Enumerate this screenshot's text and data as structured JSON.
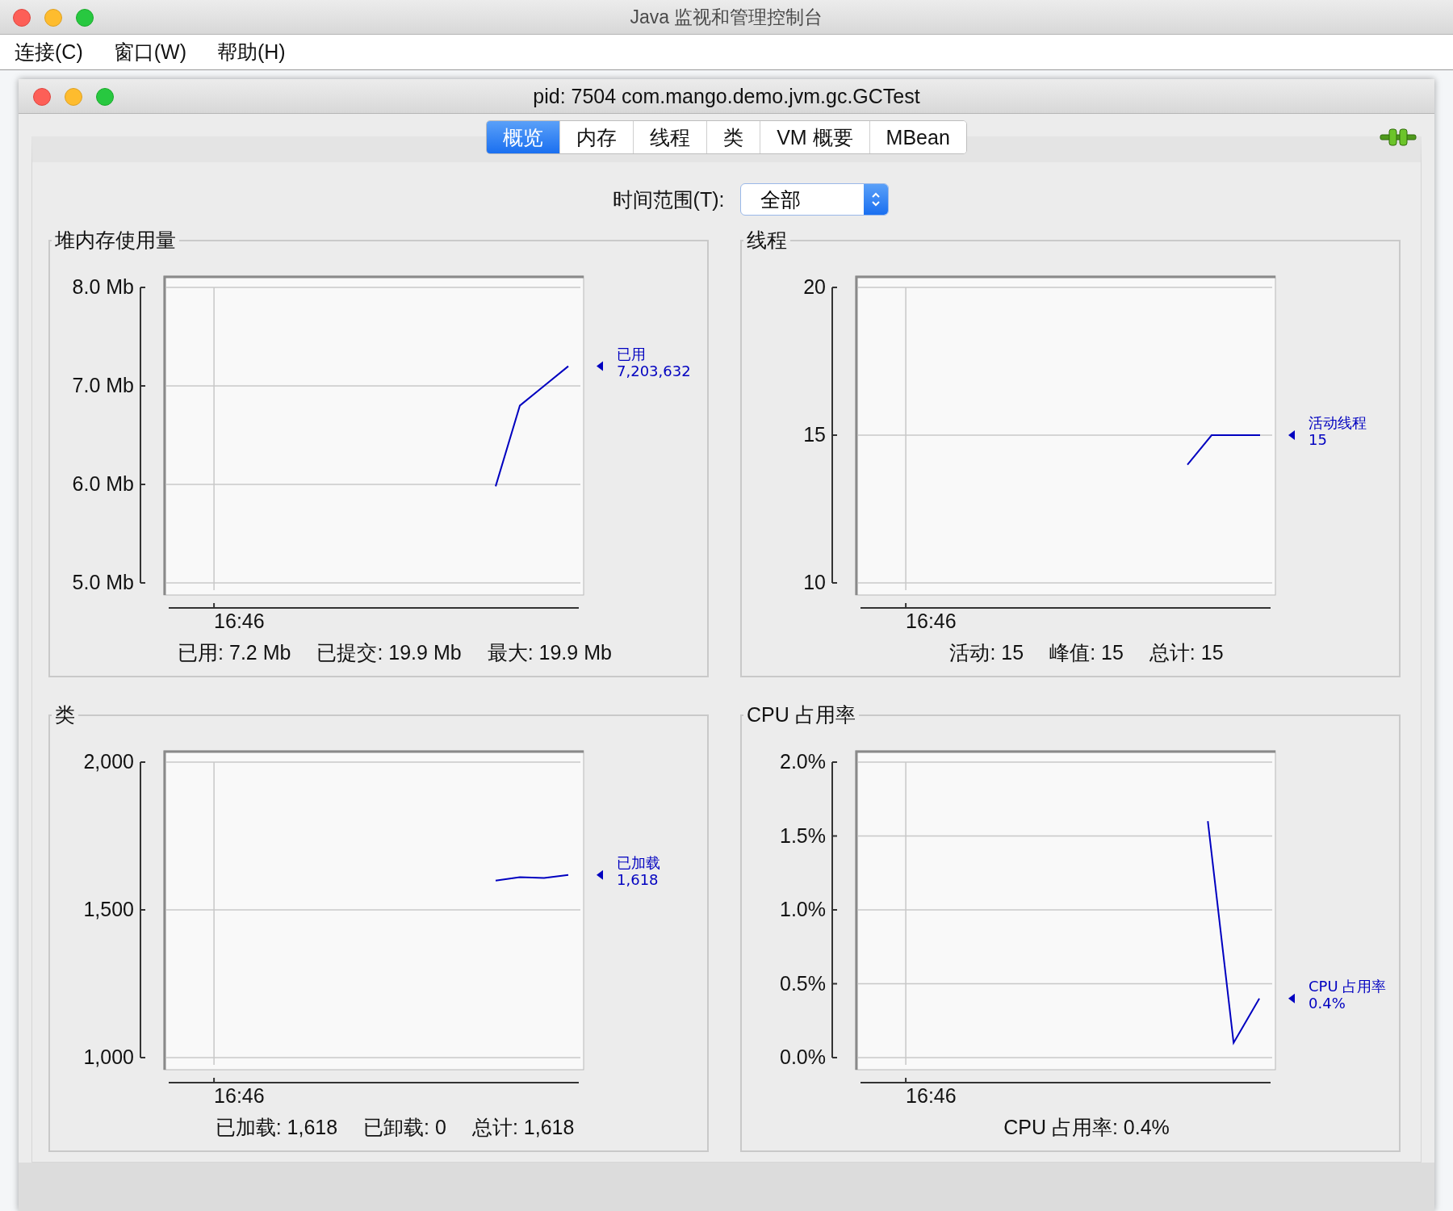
{
  "app_window": {
    "title": "Java 监视和管理控制台"
  },
  "menu": [
    "连接(C)",
    "窗口(W)",
    "帮助(H)"
  ],
  "document_window": {
    "title": "pid: 7504 com.mango.demo.jvm.gc.GCTest"
  },
  "tabs": [
    {
      "label": "概览",
      "selected": true
    },
    {
      "label": "内存",
      "selected": false
    },
    {
      "label": "线程",
      "selected": false
    },
    {
      "label": "类",
      "selected": false
    },
    {
      "label": "VM 概要",
      "selected": false
    },
    {
      "label": "MBean",
      "selected": false
    }
  ],
  "time_range": {
    "label": "时间范围(T):",
    "value": "全部"
  },
  "panels": [
    {
      "title": "堆内存使用量",
      "legend_value": "7,203,632",
      "stats": [
        "已用: 7.2 Mb",
        "已提交: 19.9 Mb",
        "最大: 19.9 Mb"
      ],
      "chart_data": {
        "type": "line",
        "grid": true,
        "annotations": [
          "16:46"
        ],
        "ylim": [
          5,
          8
        ],
        "yticks": [
          {
            "value": 5,
            "label": "5.0 Mb"
          },
          {
            "value": 6,
            "label": "6.0 Mb"
          },
          {
            "value": 7,
            "label": "7.0 Mb"
          },
          {
            "value": 8,
            "label": "8.0 Mb"
          }
        ],
        "series": [
          {
            "name": "已用",
            "color": "#0000c0",
            "values": [
              null,
              null,
              null,
              null,
              null,
              null,
              null,
              null,
              null,
              null,
              null,
              null,
              null,
              5.98,
              6.8,
              7.0,
              7.2
            ]
          }
        ]
      }
    },
    {
      "title": "线程",
      "legend_value": "15",
      "stats": [
        "活动: 15",
        "峰值: 15",
        "总计: 15"
      ],
      "chart_data": {
        "type": "line",
        "grid": true,
        "annotations": [
          "16:46"
        ],
        "ylim": [
          10,
          20
        ],
        "yticks": [
          {
            "value": 10,
            "label": "10"
          },
          {
            "value": 15,
            "label": "15"
          },
          {
            "value": 20,
            "label": "20"
          }
        ],
        "series": [
          {
            "name": "活动线程",
            "color": "#0000c0",
            "values": [
              null,
              null,
              null,
              null,
              null,
              null,
              null,
              null,
              null,
              null,
              null,
              null,
              null,
              14,
              15,
              15,
              15
            ]
          }
        ]
      }
    },
    {
      "title": "类",
      "legend_value": "1,618",
      "stats": [
        "已加载: 1,618",
        "已卸载: 0",
        "总计: 1,618"
      ],
      "chart_data": {
        "type": "line",
        "grid": true,
        "annotations": [
          "16:46"
        ],
        "ylim": [
          1000,
          2000
        ],
        "yticks": [
          {
            "value": 1000,
            "label": "1,000"
          },
          {
            "value": 1500,
            "label": "1,500"
          },
          {
            "value": 2000,
            "label": "2,000"
          }
        ],
        "series": [
          {
            "name": "已加载",
            "color": "#0000c0",
            "values": [
              null,
              null,
              null,
              null,
              null,
              null,
              null,
              null,
              null,
              null,
              null,
              null,
              null,
              1599,
              1611,
              1608,
              1618
            ]
          }
        ]
      }
    },
    {
      "title": "CPU 占用率",
      "legend_value": "0.4%",
      "stats": [
        "CPU 占用率: 0.4%"
      ],
      "chart_data": {
        "type": "line",
        "grid": true,
        "annotations": [
          "16:46"
        ],
        "ylim": [
          0,
          2
        ],
        "yticks": [
          {
            "value": 0,
            "label": "0.0%"
          },
          {
            "value": 0.5,
            "label": "0.5%"
          },
          {
            "value": 1,
            "label": "1.0%"
          },
          {
            "value": 1.5,
            "label": "1.5%"
          },
          {
            "value": 2,
            "label": "2.0%"
          }
        ],
        "series": [
          {
            "name": "CPU 占用率",
            "color": "#0000c0",
            "values": [
              null,
              null,
              null,
              null,
              null,
              null,
              null,
              null,
              null,
              null,
              null,
              null,
              null,
              1.6,
              0.1,
              0.4
            ]
          }
        ]
      }
    }
  ]
}
